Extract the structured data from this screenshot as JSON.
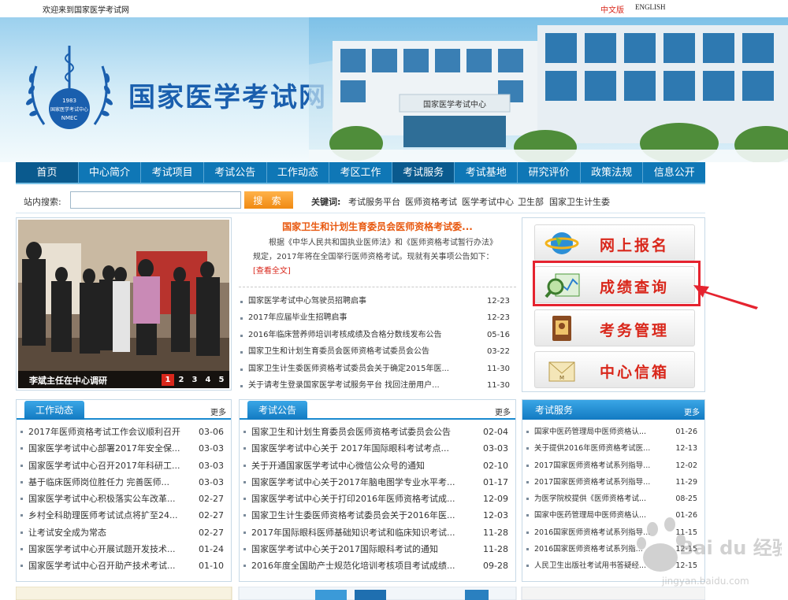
{
  "topbar": {
    "welcome": "欢迎来到国家医学考试网",
    "lang_cn": "中文版",
    "lang_en": "ENGLISH"
  },
  "banner": {
    "site_title": "国家医学考试网",
    "logo_year": "1983",
    "logo_org": "国家医学考试中心",
    "logo_abbr": "NMEC",
    "building_sign": "国家医学考试中心"
  },
  "nav": {
    "items": [
      "首页",
      "中心简介",
      "考试项目",
      "考试公告",
      "工作动态",
      "考区工作",
      "考试服务",
      "考试基地",
      "研究评价",
      "政策法规",
      "信息公开"
    ]
  },
  "search": {
    "label": "站内搜索:",
    "value": "",
    "button": "搜 索",
    "keywords_label": "关键词:",
    "keywords": [
      "考试服务平台",
      "医师资格考试",
      "医学考试中心",
      "卫生部",
      "国家卫生计生委"
    ]
  },
  "slideshow": {
    "caption": "李斌主任在中心调研",
    "pages": [
      "1",
      "2",
      "3",
      "4",
      "5"
    ],
    "active_page": "1"
  },
  "featured": {
    "headline": "国家卫生和计划生育委员会医师资格考试委...",
    "summary": "根据《中华人民共和国执业医师法》和《医师资格考试暂行办法》规定，2017年将在全国举行医师资格考试。现就有关事项公告如下：",
    "more": "[查看全文]"
  },
  "news": [
    {
      "title": "国家医学考试中心驾驶员招聘启事",
      "date": "12-23"
    },
    {
      "title": "2017年应届毕业生招聘启事",
      "date": "12-23"
    },
    {
      "title": "2016年临床营养师培训考核成绩及合格分数线发布公告",
      "date": "05-16"
    },
    {
      "title": "国家卫生和计划生育委员会医师资格考试委员会公告",
      "date": "03-22"
    },
    {
      "title": "国家卫生计生委医师资格考试委员会关于确定2015年医...",
      "date": "11-30"
    },
    {
      "title": "关于请考生登录国家医学考试服务平台 找回注册用户...",
      "date": "11-30"
    }
  ],
  "quick": {
    "items": [
      "网上报名",
      "成绩查询",
      "考务管理",
      "中心信箱"
    ]
  },
  "panels": [
    {
      "title": "工作动态",
      "more": "更多",
      "rows": [
        {
          "title": "2017年医师资格考试工作会议顺利召开",
          "date": "03-06"
        },
        {
          "title": "国家医学考试中心部署2017年安全保...",
          "date": "03-03"
        },
        {
          "title": "国家医学考试中心召开2017年科研工...",
          "date": "03-03"
        },
        {
          "title": "基于临床医师岗位胜任力 完善医师...",
          "date": "03-03"
        },
        {
          "title": "国家医学考试中心积极落实公车改革...",
          "date": "02-27"
        },
        {
          "title": "乡村全科助理医师考试试点将扩至24...",
          "date": "02-27"
        },
        {
          "title": "让考试安全成为常态",
          "date": "02-27"
        },
        {
          "title": "国家医学考试中心开展试题开发技术...",
          "date": "01-24"
        },
        {
          "title": "国家医学考试中心召开助产技术考试...",
          "date": "01-10"
        }
      ]
    },
    {
      "title": "考试公告",
      "more": "更多",
      "rows": [
        {
          "title": "国家卫生和计划生育委员会医师资格考试委员会公告",
          "date": "02-04"
        },
        {
          "title": "国家医学考试中心关于 2017年国际眼科考试考点...",
          "date": "03-03"
        },
        {
          "title": "关于开通国家医学考试中心微信公众号的通知",
          "date": "02-10"
        },
        {
          "title": "国家医学考试中心关于2017年脑电图学专业水平考...",
          "date": "01-17"
        },
        {
          "title": "国家医学考试中心关于打印2016年医师资格考试成...",
          "date": "12-09"
        },
        {
          "title": "国家卫生计生委医师资格考试委员会关于2016年医...",
          "date": "12-03"
        },
        {
          "title": "2017年国际眼科医师基础知识考试和临床知识考试...",
          "date": "11-28"
        },
        {
          "title": "国家医学考试中心关于2017国际眼科考试的通知",
          "date": "11-28"
        },
        {
          "title": "2016年度全国助产士规范化培训考核项目考试成绩...",
          "date": "09-28"
        }
      ]
    },
    {
      "title": "考试服务",
      "more": "更多",
      "rows": [
        {
          "title": "国家中医药管理局中医师资格认...",
          "date": "01-26"
        },
        {
          "title": "关于提供2016年医师资格考试医...",
          "date": "12-13"
        },
        {
          "title": "2017国家医师资格考试系列指导...",
          "date": "12-02"
        },
        {
          "title": "2017国家医师资格考试系列指导...",
          "date": "11-29"
        },
        {
          "title": "为医学院校提供《医师资格考试...",
          "date": "08-25"
        },
        {
          "title": "国家中医药管理局中医师资格认...",
          "date": "01-26"
        },
        {
          "title": "2016国家医师资格考试系列指导...",
          "date": "11-15"
        },
        {
          "title": "2016国家医师资格考试系列指...",
          "date": "12-15"
        },
        {
          "title": "人民卫生出版社考试用书答疑经...",
          "date": "12-15"
        }
      ]
    }
  ],
  "watermark": {
    "text": "Bai du 经验",
    "sub": "jingyan.baidu.com"
  },
  "colors": {
    "nav_blue": "#0f77b6",
    "accent_red": "#d9271b",
    "headline_orange": "#e8580f",
    "title_blue": "#1a5fae"
  }
}
